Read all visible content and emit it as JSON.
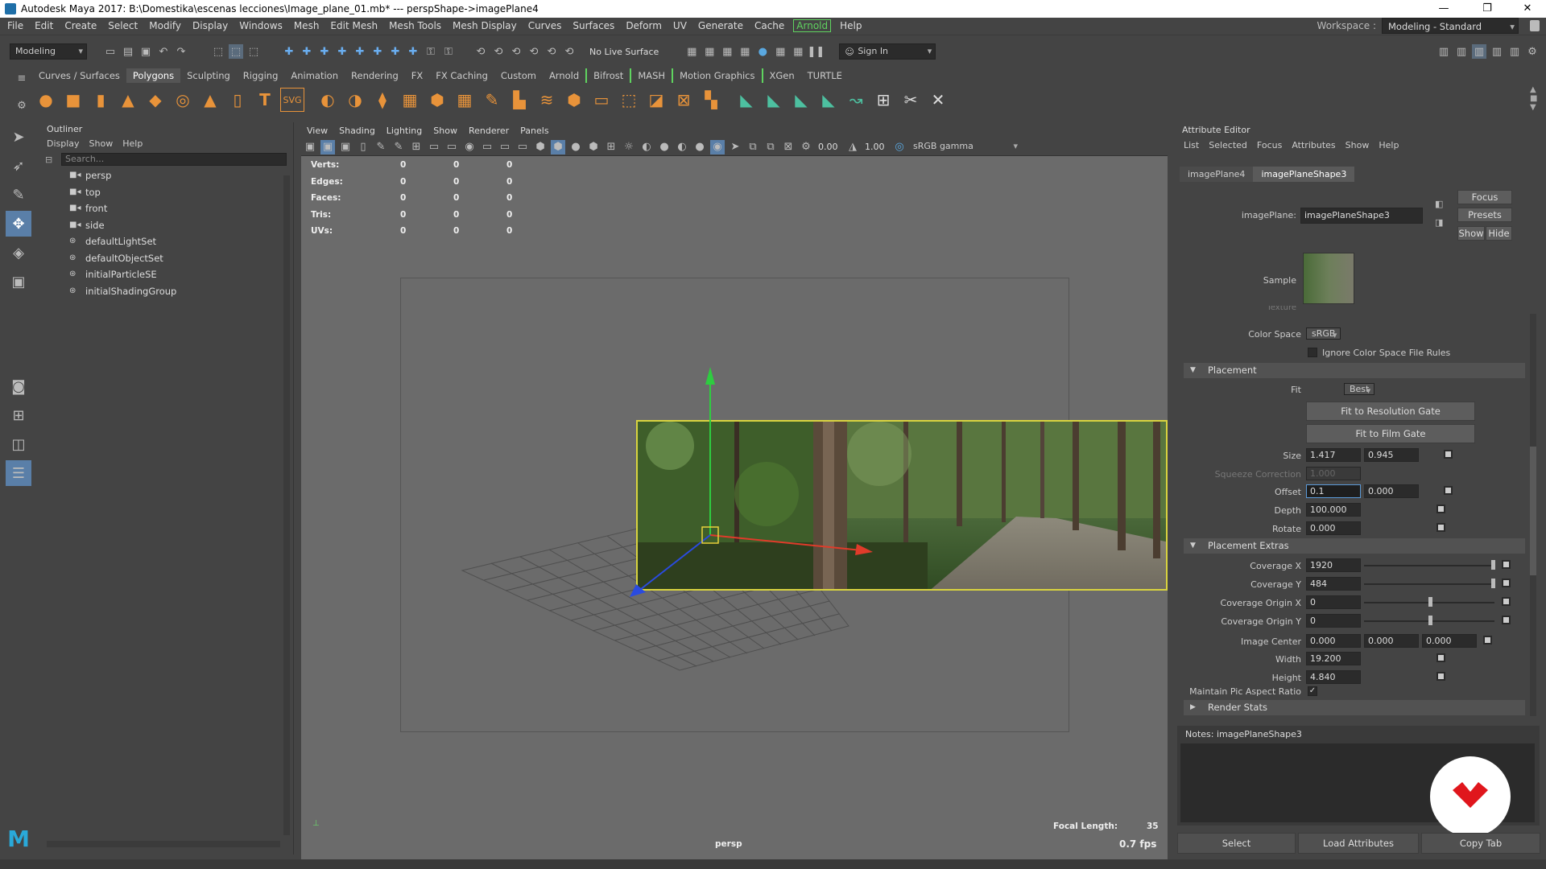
{
  "window": {
    "title": "Autodesk Maya 2017: B:\\Domestika\\escenas lecciones\\Image_plane_01.mb*   ---   perspShape->imagePlane4",
    "min": "—",
    "max": "❐",
    "close": "✕"
  },
  "menubar": {
    "items": [
      "File",
      "Edit",
      "Create",
      "Select",
      "Modify",
      "Display",
      "Windows",
      "Mesh",
      "Edit Mesh",
      "Mesh Tools",
      "Mesh Display",
      "Curves",
      "Surfaces",
      "Deform",
      "UV",
      "Generate",
      "Cache"
    ],
    "arnold": "Arnold",
    "help": "Help",
    "workspace_label": "Workspace :",
    "workspace_value": "Modeling - Standard"
  },
  "statusline": {
    "mode": "Modeling",
    "live_surface": "No Live Surface",
    "sign_in": "Sign In"
  },
  "shelf": {
    "tabs": [
      "Curves / Surfaces",
      "Polygons",
      "Sculpting",
      "Rigging",
      "Animation",
      "Rendering",
      "FX",
      "FX Caching",
      "Custom",
      "Arnold",
      "Bifrost",
      "MASH",
      "Motion Graphics",
      "XGen",
      "TURTLE"
    ],
    "active": "Polygons"
  },
  "outliner": {
    "title": "Outliner",
    "menu": [
      "Display",
      "Show",
      "Help"
    ],
    "search_placeholder": "Search...",
    "items": [
      {
        "icon": "camera-icon",
        "label": "persp"
      },
      {
        "icon": "camera-icon",
        "label": "top"
      },
      {
        "icon": "camera-icon",
        "label": "front"
      },
      {
        "icon": "camera-icon",
        "label": "side"
      },
      {
        "icon": "set-icon",
        "label": "defaultLightSet"
      },
      {
        "icon": "set-icon",
        "label": "defaultObjectSet"
      },
      {
        "icon": "set-icon",
        "label": "initialParticleSE"
      },
      {
        "icon": "set-icon",
        "label": "initialShadingGroup"
      }
    ]
  },
  "viewport": {
    "menu": [
      "View",
      "Shading",
      "Lighting",
      "Show",
      "Renderer",
      "Panels"
    ],
    "field1": "0.00",
    "field2": "1.00",
    "colorspace": "sRGB gamma",
    "hud": [
      {
        "label": "Verts:",
        "a": "0",
        "b": "0",
        "c": "0"
      },
      {
        "label": "Edges:",
        "a": "0",
        "b": "0",
        "c": "0"
      },
      {
        "label": "Faces:",
        "a": "0",
        "b": "0",
        "c": "0"
      },
      {
        "label": "Tris:",
        "a": "0",
        "b": "0",
        "c": "0"
      },
      {
        "label": "UVs:",
        "a": "0",
        "b": "0",
        "c": "0"
      }
    ],
    "focal_label": "Focal Length:",
    "focal_value": "35",
    "camera": "persp",
    "fps": "0.7 fps"
  },
  "attr": {
    "title": "Attribute Editor",
    "menu": [
      "List",
      "Selected",
      "Focus",
      "Attributes",
      "Show",
      "Help"
    ],
    "tabs": [
      "imagePlane4",
      "imagePlaneShape3"
    ],
    "node_label": "imagePlane:",
    "node_value": "imagePlaneShape3",
    "focus": "Focus",
    "presets": "Presets",
    "show": "Show",
    "hide": "Hide",
    "sample": "Sample",
    "texture": "Texture",
    "color_space_label": "Color Space",
    "color_space": "sRGB",
    "ignore_cs": "Ignore Color Space File Rules",
    "placement": "Placement",
    "fit_label": "Fit",
    "fit": "Best",
    "fit_res": "Fit to Resolution Gate",
    "fit_film": "Fit to Film Gate",
    "size_label": "Size",
    "size_x": "1.417",
    "size_y": "0.945",
    "squeeze_label": "Squeeze Correction",
    "squeeze": "1.000",
    "offset_label": "Offset",
    "offset_x": "0.1",
    "offset_y": "0.000",
    "depth_label": "Depth",
    "depth": "100.000",
    "rotate_label": "Rotate",
    "rotate": "0.000",
    "extras": "Placement Extras",
    "cov_x_label": "Coverage X",
    "cov_x": "1920",
    "cov_y_label": "Coverage Y",
    "cov_y": "484",
    "cov_ox_label": "Coverage Origin X",
    "cov_ox": "0",
    "cov_oy_label": "Coverage Origin Y",
    "cov_oy": "0",
    "center_label": "Image Center",
    "center_x": "0.000",
    "center_y": "0.000",
    "center_z": "0.000",
    "width_label": "Width",
    "width": "19.200",
    "height_label": "Height",
    "height": "4.840",
    "maintain_label": "Maintain Pic Aspect Ratio",
    "render_stats": "Render Stats",
    "notes": "Notes:  imagePlaneShape3",
    "select": "Select",
    "load": "Load Attributes",
    "copy": "Copy Tab"
  },
  "colors": {
    "accent": "#5fd35f",
    "gate": "#d9d33f"
  }
}
